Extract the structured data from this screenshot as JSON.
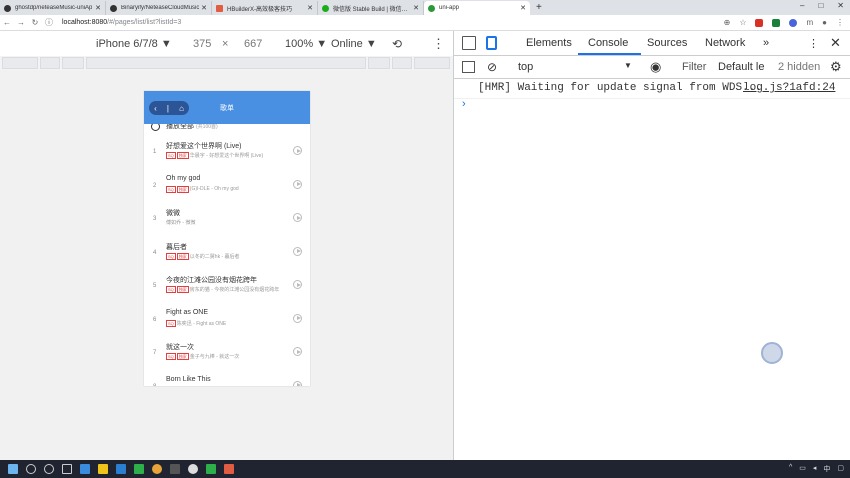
{
  "browser": {
    "tabs": [
      {
        "title": "ghostdp/neteaseMusic-uniAp",
        "icon_color": "#333333",
        "active": false
      },
      {
        "title": "Binaryify/NeteaseCloudMusic",
        "icon_color": "#333333",
        "active": false
      },
      {
        "title": "HBuilderX-高效极客技巧",
        "icon_color": "#e05d44",
        "active": false
      },
      {
        "title": "微信版 Stable Build | 微信开放",
        "icon_color": "#1aad19",
        "active": false
      },
      {
        "title": "uni-app",
        "icon_color": "#2b9939",
        "active": true
      }
    ],
    "new_tab": "+",
    "window_controls": [
      "–",
      "□",
      "✕"
    ],
    "url_host": "localhost:8080",
    "url_path": "/#/pages/list/list?listId=3"
  },
  "device_toolbar": {
    "device": "iPhone 6/7/8 ▼",
    "width": "375",
    "times": "×",
    "height": "667",
    "zoom": "100% ▼",
    "network": "Online ▼"
  },
  "phone": {
    "header_title": "歌单",
    "capsule_back": "‹",
    "capsule_sep": "|",
    "capsule_home": "⌂",
    "play_all_label": "播放全部",
    "play_all_count": "(共100首)",
    "songs": [
      {
        "index": "1",
        "name": "好想爱这个世界啊 (Live)",
        "tags": [
          "SQ",
          "独家"
        ],
        "sub": "华晨宇 - 好想爱这个世界啊 (Live)"
      },
      {
        "index": "2",
        "name": "Oh my god",
        "tags": [
          "SQ",
          "独家"
        ],
        "sub": "(G)I-DLE - Oh my god"
      },
      {
        "index": "3",
        "name": "微微",
        "tags": [],
        "sub": "傅如乔 - 微微"
      },
      {
        "index": "4",
        "name": "暮后者",
        "tags": [
          "SQ",
          "独家"
        ],
        "sub": "以冬的二舅hk - 暮后者"
      },
      {
        "index": "5",
        "name": "今夜的江滩公园没有烟花跨年",
        "tags": [
          "SQ",
          "独家"
        ],
        "sub": "房东的猫 - 今夜的江滩公园没有烟花跨年"
      },
      {
        "index": "6",
        "name": "Fight as ONE",
        "tags": [
          "SQ"
        ],
        "sub": "陈奕迅 - Fight as ONE"
      },
      {
        "index": "7",
        "name": "就这一次",
        "tags": [
          "SQ",
          "独家"
        ],
        "sub": "金子与九棒 - 就这一次"
      },
      {
        "index": "8",
        "name": "Born Like This",
        "tags": [],
        "sub": ""
      }
    ]
  },
  "devtools": {
    "tabs": [
      "Elements",
      "Console",
      "Sources",
      "Network",
      "»"
    ],
    "active_tab": "Console",
    "context": "top",
    "filter_placeholder": "Filter",
    "levels": "Default le",
    "hidden": "2 hidden",
    "console_message": "[HMR] Waiting for update signal from WDS...",
    "console_source": "log.js?1afd:24",
    "prompt": "›"
  },
  "colors": {
    "phone_header": "#4a90e2",
    "accent": "#1a73e8",
    "taskbar": "#1f2430"
  }
}
